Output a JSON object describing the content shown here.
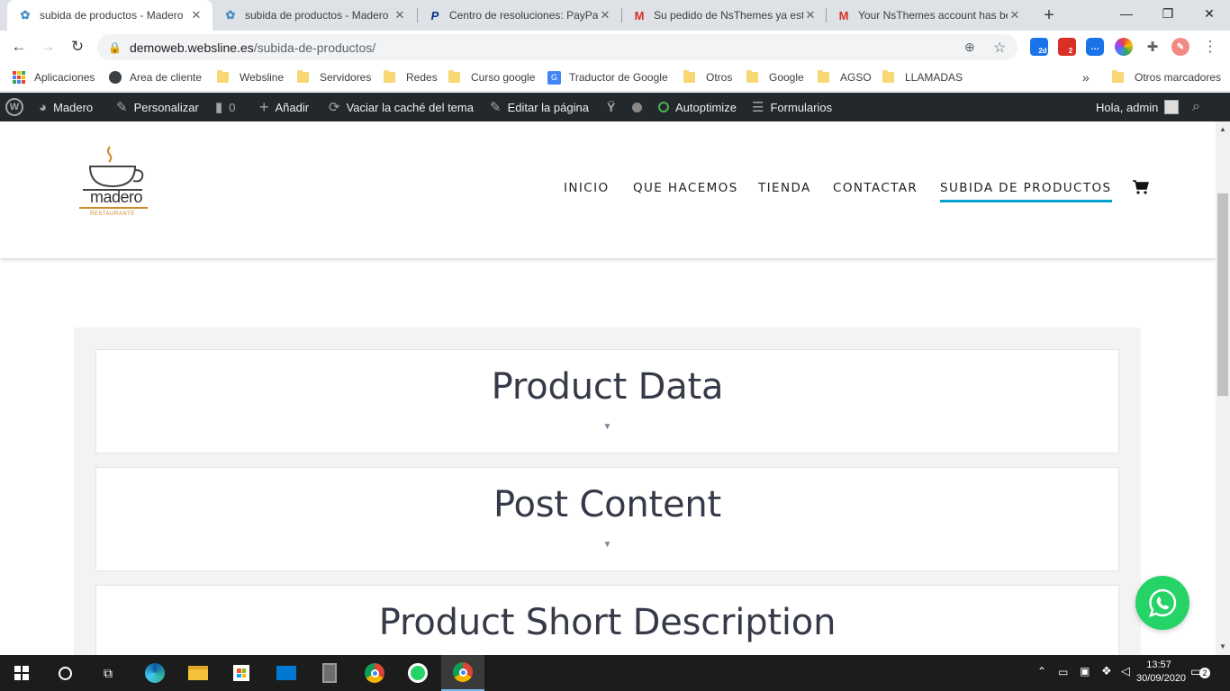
{
  "tabs": [
    {
      "title": "subida de productos - Madero",
      "active": true
    },
    {
      "title": "subida de productos - Madero",
      "active": false
    },
    {
      "title": "Centro de resoluciones: PayPal",
      "active": false
    },
    {
      "title": "Su pedido de NsThemes ya est",
      "active": false
    },
    {
      "title": "Your NsThemes account has be",
      "active": false
    }
  ],
  "address": {
    "host": "demoweb.websline.es",
    "path": "/subida-de-productos/"
  },
  "extensions": {
    "badge_a": "2d",
    "badge_b": "2"
  },
  "bookmarks": [
    {
      "label": "Aplicaciones",
      "icon": "apps-grid-icon"
    },
    {
      "label": "Area de cliente",
      "icon": "globe-icon"
    },
    {
      "label": "Websline",
      "icon": "folder-icon"
    },
    {
      "label": "Servidores",
      "icon": "folder-icon"
    },
    {
      "label": "Redes",
      "icon": "folder-icon"
    },
    {
      "label": "Curso google",
      "icon": "folder-icon"
    },
    {
      "label": "Traductor de Google",
      "icon": "translate-icon"
    },
    {
      "label": "Otros",
      "icon": "folder-icon"
    },
    {
      "label": "Google",
      "icon": "folder-icon"
    },
    {
      "label": "AGSO",
      "icon": "folder-icon"
    },
    {
      "label": "LLAMADAS",
      "icon": "folder-icon"
    }
  ],
  "bookmarks_more": "»",
  "other_bookmarks": "Otros marcadores",
  "wpbar": {
    "site": "Madero",
    "customize": "Personalizar",
    "comments": "0",
    "add": "Añadir",
    "cache": "Vaciar la caché del tema",
    "edit": "Editar la página",
    "autoptimize": "Autoptimize",
    "forms": "Formularios",
    "greeting": "Hola, admin"
  },
  "logo": {
    "name": "madero",
    "sub": "RESTAURANTE"
  },
  "nav": [
    {
      "label": "INICIO",
      "active": false
    },
    {
      "label": "QUE HACEMOS",
      "active": false
    },
    {
      "label": "TIENDA",
      "active": false
    },
    {
      "label": "CONTACTAR",
      "active": false
    },
    {
      "label": "SUBIDA DE PRODUCTOS",
      "active": true
    }
  ],
  "sections": [
    {
      "title": "Product Data"
    },
    {
      "title": "Post Content"
    },
    {
      "title": "Product Short Description"
    }
  ],
  "caret": "▼",
  "taskbar": {
    "time": "13:57",
    "date": "30/09/2020",
    "notifications": "2"
  },
  "colors": {
    "accent": "#00a0d2",
    "whatsapp": "#25d366",
    "wp_bar": "#23282d"
  }
}
